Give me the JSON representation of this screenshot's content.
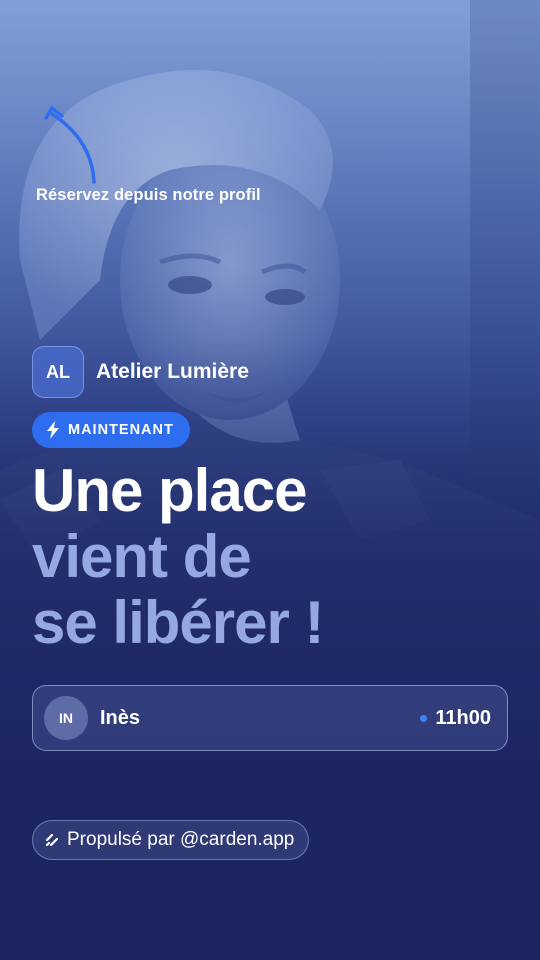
{
  "hint": {
    "text": "Réservez depuis notre profil"
  },
  "business": {
    "initials": "AL",
    "name": "Atelier Lumière"
  },
  "badge": {
    "label": "MAINTENANT",
    "icon": "lightning-icon"
  },
  "headline": {
    "line1": "Une place",
    "line2": "vient de",
    "line3": "se libérer !"
  },
  "slot": {
    "initials": "IN",
    "name": "Inès",
    "time": "11h00"
  },
  "footer": {
    "label": "Propulsé par @carden.app",
    "icon": "carden-logo-icon"
  },
  "colors": {
    "accent": "#2f6df0",
    "background": "#1c2560",
    "headline_secondary": "#95a8e0"
  }
}
